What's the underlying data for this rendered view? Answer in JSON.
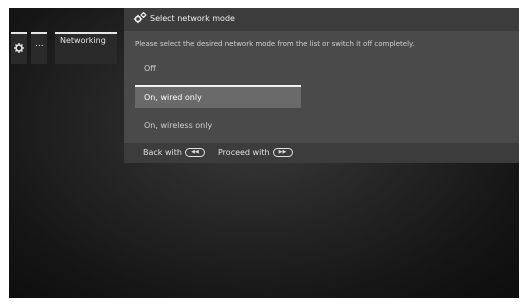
{
  "breadcrumb": {
    "ellipsis": "...",
    "current": "Networking"
  },
  "dialog": {
    "title": "Select network mode",
    "instruction": "Please select the desired network mode from the list or switch it off completely.",
    "options": [
      {
        "label": "Off",
        "selected": false
      },
      {
        "label": "On, wired only",
        "selected": true
      },
      {
        "label": "On, wireless only",
        "selected": false
      }
    ],
    "footer": {
      "back_label": "Back with",
      "back_button_glyph": "◀◀",
      "proceed_label": "Proceed with",
      "proceed_button_glyph": "▶▶"
    }
  },
  "icons": {
    "breadcrumb_icon": "gear-icon",
    "title_icon": "gears-icon"
  }
}
